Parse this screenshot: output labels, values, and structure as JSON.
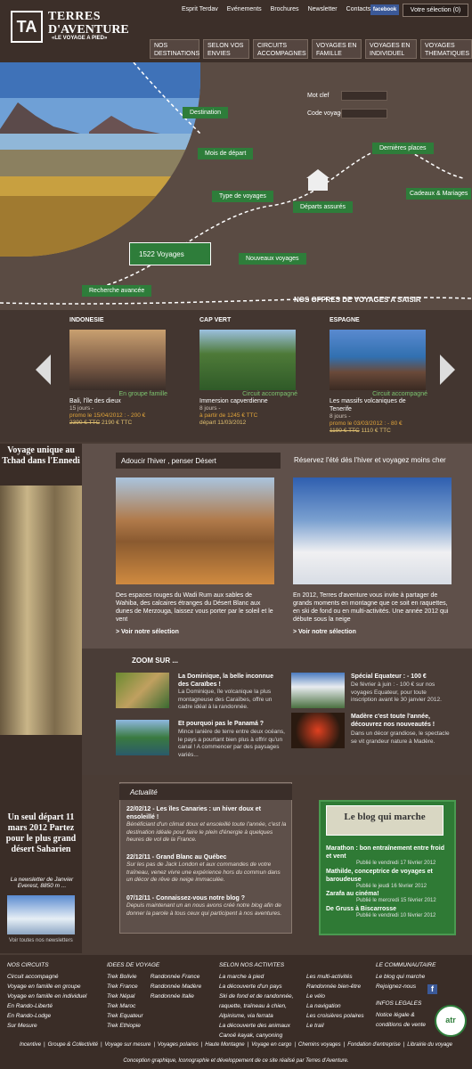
{
  "brand": {
    "logo": "TA",
    "line1": "TERRES",
    "line2": "D'AVENTURE",
    "tagline": "«LE VOYAGE A PIED»"
  },
  "top_links": [
    "Esprit Terdav",
    "Evénements",
    "Brochures",
    "Newsletter",
    "Contacts"
  ],
  "facebook": "facebook",
  "selection": "Votre sélection (0)",
  "nav": [
    "NOS DESTINATIONS",
    "SELON VOS ENVIES",
    "CIRCUITS ACCOMPAGNES",
    "VOYAGES EN FAMILLE",
    "VOYAGES EN INDIVIDUEL",
    "VOYAGES THEMATIQUES"
  ],
  "search": {
    "keyword_label": "Mot clef",
    "code_label": "Code voyage"
  },
  "hero_buttons": {
    "destination": "Destination",
    "depart": "Mois de départ",
    "type": "Type de voyages",
    "count": "1522 Voyages",
    "advanced": "Recherche avancée",
    "nouveaux": "Nouveaux voyages",
    "departs": "Départs assurés",
    "dernieres": "Dernières places",
    "cadeaux": "Cadeaux & Mariages"
  },
  "offers_title": "NOS OFFRES DE VOYAGES A SAISIR",
  "offers": [
    {
      "country": "INDONESIE",
      "tag": "En groupe famille",
      "title": "Bali, l'île des dieux",
      "duration": "15 jours -",
      "promo": "promo le 15/04/2012 : - 200 €",
      "price_old": "2390 € TTC",
      "price": "2190 € TTC"
    },
    {
      "country": "CAP VERT",
      "tag": "Circuit accompagné",
      "title": "Immersion capverdienne",
      "duration": "8 jours -",
      "promo": "à partir de 1245 € TTC",
      "price_old": "",
      "price": "départ 11/03/2012"
    },
    {
      "country": "ESPAGNE",
      "tag": "Circuit accompagné",
      "title": "Les massifs volcaniques de Tenerife",
      "duration": "8 jours -",
      "promo": "promo le 03/03/2012 : - 80 €",
      "price_old": "1190 € TTC",
      "price": "1110 € TTC"
    }
  ],
  "ad": {
    "title": "Voyage unique au Tchad dans l'Ennedi",
    "bottom": "Un seul départ 11 mars 2012 Partez pour le plus grand désert Saharien"
  },
  "newsletter": {
    "title": "La newsletter de Janvier Everest, 8850 m ...",
    "all": "Voir toutes nos newsletters"
  },
  "winter": {
    "title_left": "Adoucir l'hiver , penser Désert",
    "title_right": "Réservez l'été dès l'hiver et voyagez moins cher",
    "text_left": "Des espaces rouges du Wadi Rum aux sables de Wahiba, des calcaires étranges du Désert Blanc aux dunes de Merzouga, laissez vous porter par le soleil et le vent",
    "text_right": "En 2012, Terres d'aventure vous invite à partager de grands moments en montagne que ce soit en raquettes, en ski de fond ou en multi-activités. Une année 2012 qui débute sous la neige",
    "link": "> Voir notre sélection"
  },
  "zoom": {
    "title": "ZOOM SUR ...",
    "items": [
      {
        "title": "La Dominique, la belle inconnue des Caraïbes !",
        "desc": "La Dominique, île volcanique la plus montagneuse des Caraïbes, offre un cadre idéal à la randonnée."
      },
      {
        "title": "Spécial Equateur : - 100 €",
        "desc": "De février à juin : - 100 € sur nos voyages Equateur, pour toute inscription avant le 30 janvier 2012."
      },
      {
        "title": "Et pourquoi pas le Panamá ?",
        "desc": "Mince lanière de terre entre deux océans, le pays a pourtant bien plus à offrir qu'un canal ! A commencer par des paysages variés..."
      },
      {
        "title": "Madère c'est toute l'année, découvrez nos nouveautés !",
        "desc": "Dans un décor grandiose, le spectacle se vit grandeur nature à Madère."
      }
    ]
  },
  "actualite": {
    "title": "Actualité",
    "items": [
      {
        "title": "22/02/12 - Les îles Canaries : un hiver doux et ensoleillé !",
        "desc": "Bénéficiant d'un climat doux et ensoleillé toute l'année, c'est la destination idéale pour faire le plein d'énergie à quelques heures de vol de la France."
      },
      {
        "title": "22/12/11 - Grand Blanc au Québec",
        "desc": "Sur les pas de Jack London et aux commandes de votre traîneau, venez vivre une expérience hors du commun dans un décor de rêve de neige immaculée."
      },
      {
        "title": "07/12/11 - Connaissez-vous notre blog ?",
        "desc": "Depuis maintenant un an nous avons créé notre blog afin de donner la parole à tous ceux qui participent à nos aventures."
      }
    ]
  },
  "blog": {
    "title": "Le blog qui marche",
    "posts": [
      {
        "title": "Marathon : bon entraînement entre froid et vent",
        "date": "Publié le vendredi 17 février 2012"
      },
      {
        "title": "Mathilde, conceptrice de voyages et baroudeuse",
        "date": "Publié le jeudi 16 février 2012"
      },
      {
        "title": "Zarafa au cinéma!",
        "date": "Publié le mercredi 15 février 2012"
      },
      {
        "title": "De Gruss à Biscarrosse",
        "date": "Publié le vendredi 10 février 2012"
      }
    ]
  },
  "footer": {
    "circuits": {
      "title": "NOS CIRCUITS",
      "links": [
        "Circuit accompagné",
        "Voyage en famille en groupe",
        "Voyage en famille en individuel",
        "En Rando-Liberté",
        "En Rando-Lodge",
        "Sur Mesure"
      ]
    },
    "idees": {
      "title": "IDEES DE VOYAGE",
      "col1": [
        "Trek Bolivie",
        "Trek France",
        "Trek Népal",
        "Trek Maroc",
        "Trek Equateur",
        "Trek Ethiopie"
      ],
      "col2": [
        "Randonnée France",
        "Randonnée Madère",
        "Randonnée Italie"
      ]
    },
    "activites": {
      "title": "SELON NOS ACTIVITES",
      "col1": [
        "La marche à pied",
        "La découverte d'un pays",
        "Ski de fond et de randonnée, raquette, traîneau à chien,",
        "Alpinisme, via ferrata",
        "La découverte des animaux",
        "Canoë kayak, canyoning"
      ],
      "col2": [
        "Les multi-activités",
        "Randonnée bien-être",
        "Le vélo",
        "La navigation",
        "Les croisières polaires",
        "Le trail"
      ]
    },
    "communautaire": {
      "title": "LE COMMUNAUTAIRE",
      "links": [
        "Le blog qui marche",
        "Rejoignez-nous"
      ]
    },
    "infos": {
      "title": "INFOS LEGALES",
      "links": [
        "Notice légale & conditions de vente"
      ]
    },
    "bar": [
      "Incentive",
      "Groupe & Collectivité",
      "Voyage sur mesure",
      "Voyages polaires",
      "Haute Montagne",
      "Voyage en cargo",
      "Chemins voyages",
      "Fondation d'entreprise",
      "Librairie du voyage"
    ],
    "copyright": "Conception graphique, Iconographie et développement de ce site réalisé par Terres d'Aventure.",
    "atr": "atr"
  }
}
